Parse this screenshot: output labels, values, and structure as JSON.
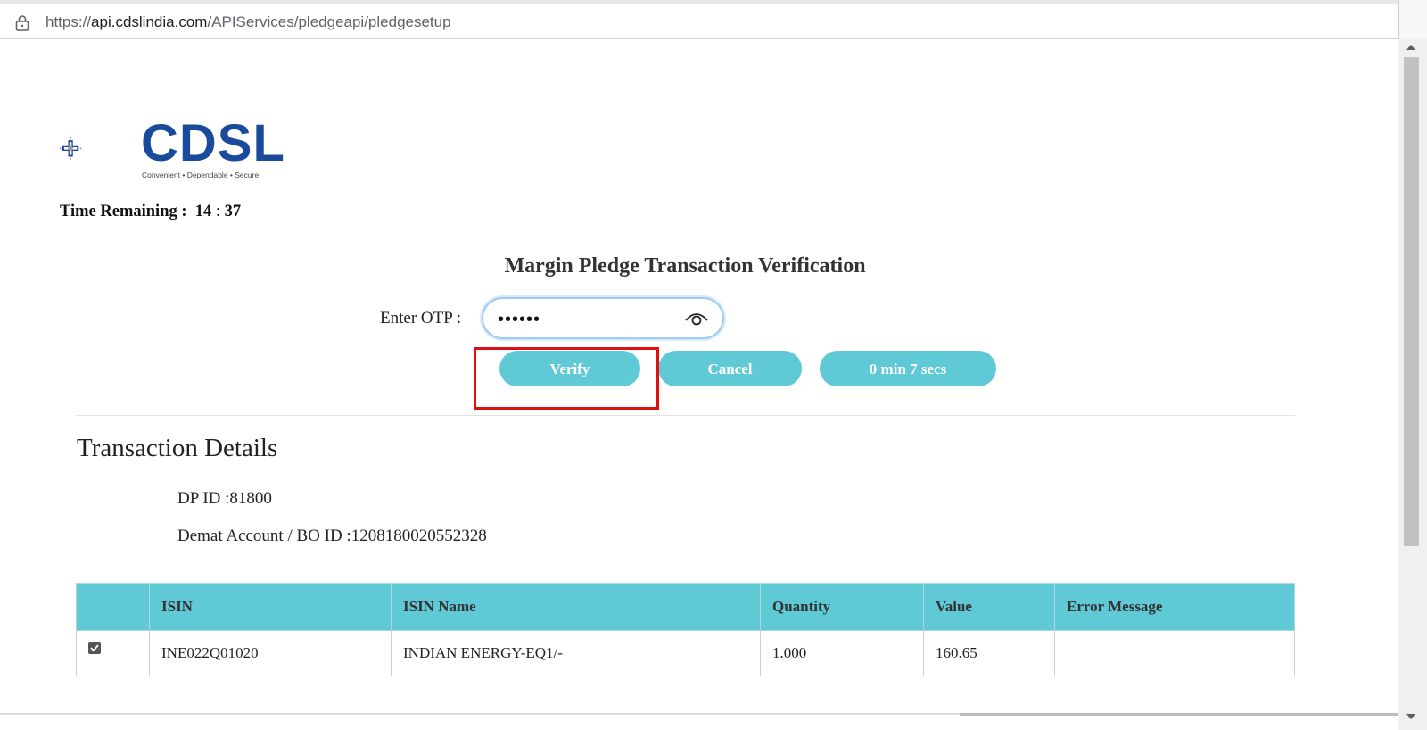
{
  "browser": {
    "url_prefix": "https://",
    "url_host": "api.cdslindia.com",
    "url_path": "/APIServices/pledgeapi/pledgesetup"
  },
  "logo": {
    "word": "CDSL",
    "tagline": "Convenient  •  Dependable  •  Secure",
    "color": "#1a4a9c"
  },
  "timer": {
    "label": "Time Remaining :",
    "minutes": "14",
    "separator": ":",
    "seconds": "37"
  },
  "verification": {
    "title": "Margin Pledge Transaction Verification",
    "otp_label": "Enter OTP :",
    "otp_value": "••••••",
    "verify_label": "Verify",
    "cancel_label": "Cancel",
    "resend_timer": "0 min 7 secs"
  },
  "details": {
    "title": "Transaction Details",
    "dp_id": "DP ID :81800",
    "bo_id": "Demat Account / BO ID :1208180020552328"
  },
  "table": {
    "headers": [
      "",
      "ISIN",
      "ISIN Name",
      "Quantity",
      "Value",
      "Error Message"
    ],
    "rows": [
      {
        "checked": true,
        "isin": "INE022Q01020",
        "name": "INDIAN ENERGY-EQ1/-",
        "quantity": "1.000",
        "value": "160.65",
        "error": ""
      }
    ]
  },
  "colors": {
    "accent": "#5fc9d6",
    "highlight": "#e01010"
  }
}
